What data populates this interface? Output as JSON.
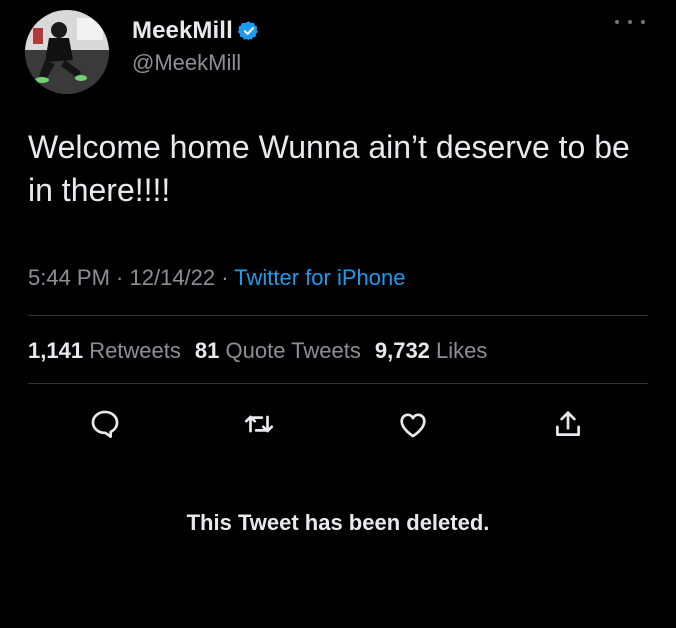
{
  "user": {
    "display_name": "MeekMill",
    "handle": "@MeekMill",
    "verified": true
  },
  "tweet": {
    "text": "Welcome home Wunna ain’t deserve to be in there!!!!"
  },
  "meta": {
    "time": "5:44 PM",
    "separator": " · ",
    "date": "12/14/22",
    "source": "Twitter for iPhone"
  },
  "stats": {
    "retweets_count": "1,141",
    "retweets_label": "Retweets",
    "quotes_count": "81",
    "quotes_label": "Quote Tweets",
    "likes_count": "9,732",
    "likes_label": "Likes"
  },
  "actions": [
    {
      "icon": "reply-icon"
    },
    {
      "icon": "retweet-icon"
    },
    {
      "icon": "like-icon"
    },
    {
      "icon": "share-icon"
    }
  ],
  "notice": {
    "deleted_text": "This Tweet has been deleted."
  },
  "colors": {
    "background": "#000000",
    "text_primary": "#e7e9ea",
    "text_secondary": "#8b9096",
    "accent": "#1d9bf0",
    "divider": "#2f3336"
  }
}
